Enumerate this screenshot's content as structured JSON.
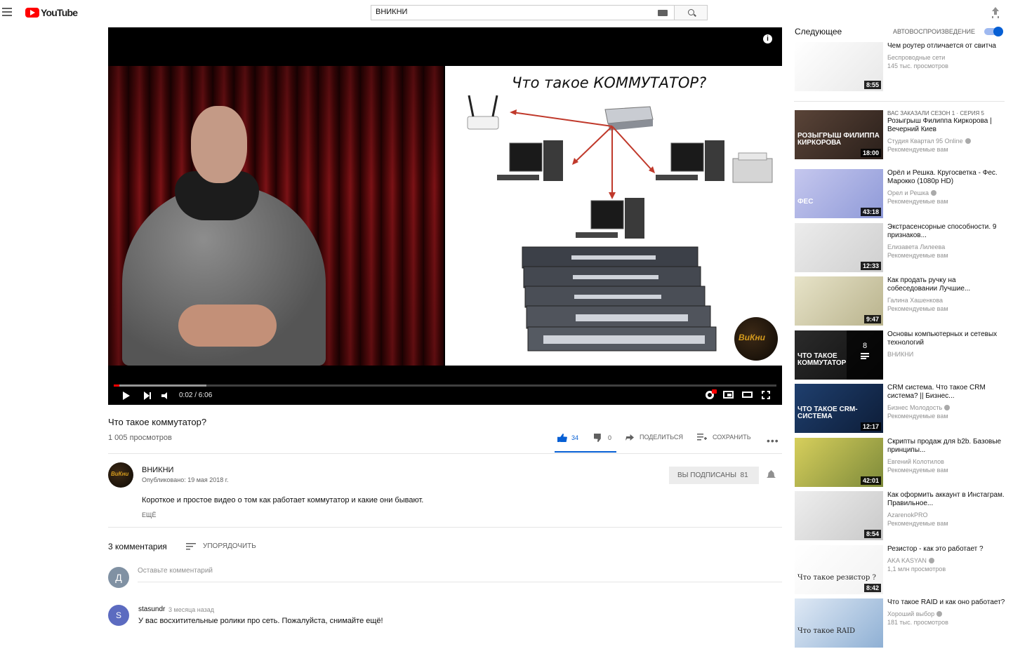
{
  "header": {
    "logo_text": "YouTube",
    "search_value": "ВНИКНИ"
  },
  "player": {
    "slide_title": "Что такое КОММУТАТОР?",
    "time": "0:02 / 6:06",
    "progress_played_fraction": 0.008,
    "progress_buffered_fraction": 0.14,
    "badge_text": "ВиКни"
  },
  "video": {
    "title": "Что такое коммутатор?",
    "views": "1 005 просмотров",
    "likes": "34",
    "dislikes": "0",
    "share_label": "ПОДЕЛИТЬСЯ",
    "save_label": "СОХРАНИТЬ",
    "more": "•••"
  },
  "channel": {
    "name": "ВНИКНИ",
    "published": "Опубликовано: 19 мая 2018 г.",
    "subscribe_label": "ВЫ ПОДПИСАНЫ",
    "subscriber_count": "81",
    "description": "Короткое и простое видео о том как работает коммутатор и какие они бывают.",
    "more_label": "ЕЩЁ"
  },
  "comments": {
    "count_label": "3 комментария",
    "sort_label": "УПОРЯДОЧИТЬ",
    "my_avatar_letter": "Д",
    "input_placeholder": "Оставьте комментарий",
    "items": [
      {
        "avatar_letter": "S",
        "author": "stasundr",
        "time": "3 месяца назад",
        "text": "У вас восхитительные ролики про сеть. Пожалуйста, снимайте ещё!"
      }
    ]
  },
  "sidebar": {
    "up_next_label": "Следующее",
    "autoplay_label": "АВТОВОСПРОИЗВЕДЕНИЕ",
    "autoplay_on": true,
    "recommendations": [
      {
        "kicker": "",
        "title": "Чем роутер отличается от свитча",
        "channel": "Беспроводные сети",
        "verified": false,
        "sub": "145 тыс. просмотров",
        "duration": "8:55",
        "thumb_colors": [
          "#ffffff",
          "#e8e8e8"
        ],
        "thumb_caption": ""
      },
      {
        "kicker": "ВАС ЗАКАЗАЛИ СЕЗОН 1 · СЕРИЯ 5",
        "title": "Розыгрыш Филиппа Киркорова | Вечерний Киев",
        "channel": "Студия Квартал 95 Online",
        "verified": true,
        "sub": "Рекомендуемые вам",
        "duration": "18:00",
        "thumb_colors": [
          "#5a4438",
          "#2a1f1a"
        ],
        "thumb_caption": "РОЗЫГРЫШ ФИЛИППА КИРКОРОВА"
      },
      {
        "kicker": "",
        "title": "Орёл и Решка. Кругосветка - Фес. Марокко (1080p HD)",
        "channel": "Орел и Решка",
        "verified": true,
        "sub": "Рекомендуемые вам",
        "duration": "43:18",
        "thumb_colors": [
          "#c5c7ee",
          "#8f9ad8"
        ],
        "thumb_caption": "ФЕС"
      },
      {
        "kicker": "",
        "title": "Экстрасенсорные способности. 9 признаков...",
        "channel": "Елизавета Лилеева",
        "verified": false,
        "sub": "Рекомендуемые вам",
        "duration": "12:33",
        "thumb_colors": [
          "#ececec",
          "#cfcfcf"
        ],
        "thumb_caption": ""
      },
      {
        "kicker": "",
        "title": "Как продать ручку на собеседовании Лучшие...",
        "channel": "Галина Хашенкова",
        "verified": false,
        "sub": "Рекомендуемые вам",
        "duration": "9:47",
        "thumb_colors": [
          "#e7e3c8",
          "#b9b38d"
        ],
        "thumb_caption": ""
      },
      {
        "kicker": "",
        "title": "Основы компьютерных и сетевых технологий",
        "channel": "ВНИКНИ",
        "verified": false,
        "sub": "",
        "duration": "",
        "thumb_colors": [
          "#2b2b2b",
          "#0f0f0f"
        ],
        "thumb_caption": "ЧТО ТАКОЕ КОММУТАТОР",
        "playlist_count": "8"
      },
      {
        "kicker": "",
        "title": "CRM система. Что такое CRM система? || Бизнес...",
        "channel": "Бизнес Молодость",
        "verified": true,
        "sub": "Рекомендуемые вам",
        "duration": "12:17",
        "thumb_colors": [
          "#1f3f6e",
          "#0d1d38"
        ],
        "thumb_caption": "ЧТО ТАКОЕ CRM-СИСТЕМА"
      },
      {
        "kicker": "",
        "title": "Скрипты продаж для b2b. Базовые принципы...",
        "channel": "Евгений Колотилов",
        "verified": false,
        "sub": "Рекомендуемые вам",
        "duration": "42:01",
        "thumb_colors": [
          "#d7cf5c",
          "#7d8a3a"
        ],
        "thumb_caption": ""
      },
      {
        "kicker": "",
        "title": "Как оформить аккаунт в Инстаграм. Правильное...",
        "channel": "AzarenokPRO",
        "verified": false,
        "sub": "Рекомендуемые вам",
        "duration": "8:54",
        "thumb_colors": [
          "#eeeeee",
          "#c9c9c9"
        ],
        "thumb_caption": ""
      },
      {
        "kicker": "",
        "title": "Резистор - как это работает ?",
        "channel": "AKA KASYAN",
        "verified": true,
        "sub": "1,1 млн просмотров",
        "duration": "8:42",
        "thumb_colors": [
          "#ffffff",
          "#f2f2f2"
        ],
        "thumb_caption": "Что такое резистор ?"
      },
      {
        "kicker": "",
        "title": "Что такое RAID и как оно работает?",
        "channel": "Хороший выбор",
        "verified": true,
        "sub": "181 тыс. просмотров",
        "duration": "",
        "thumb_colors": [
          "#dfe9f5",
          "#8fb0d4"
        ],
        "thumb_caption": "Что такое RAID"
      }
    ]
  }
}
